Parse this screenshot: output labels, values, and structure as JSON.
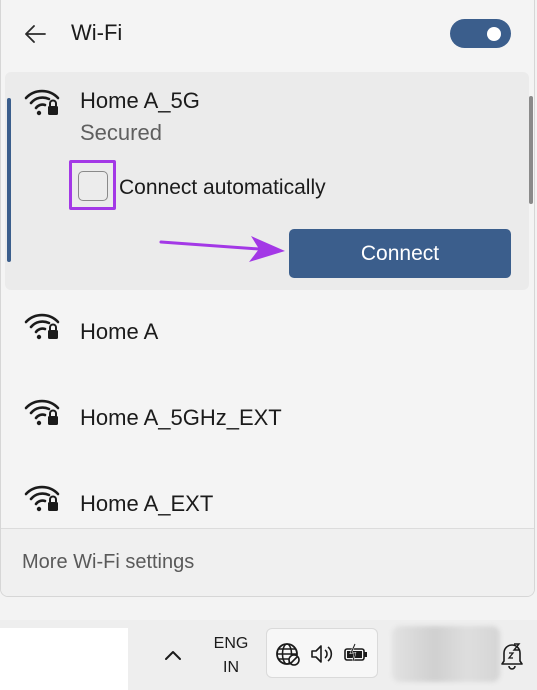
{
  "header": {
    "title": "Wi-Fi",
    "back_icon": "arrow-left-icon",
    "toggle_state": "on"
  },
  "networks": [
    {
      "name": "Home A_5G",
      "status": "Secured",
      "auto_connect_label": "Connect automatically",
      "auto_connect_checked": false,
      "connect_label": "Connect",
      "icon": "wifi-secured-icon"
    },
    {
      "name": "Home A",
      "icon": "wifi-secured-icon"
    },
    {
      "name": "Home A_5GHz_EXT",
      "icon": "wifi-secured-icon"
    },
    {
      "name": "Home A_EXT",
      "icon": "wifi-secured-icon"
    }
  ],
  "footer": {
    "more_settings_label": "More Wi-Fi settings"
  },
  "taskbar": {
    "lang_top": "ENG",
    "lang_bottom": "IN",
    "icons": [
      "chevron-up-icon",
      "globe-icon",
      "speaker-icon",
      "battery-charging-icon",
      "notification-bell-icon"
    ]
  },
  "colors": {
    "accent": "#3b5e8c",
    "highlight": "#a338e6"
  }
}
